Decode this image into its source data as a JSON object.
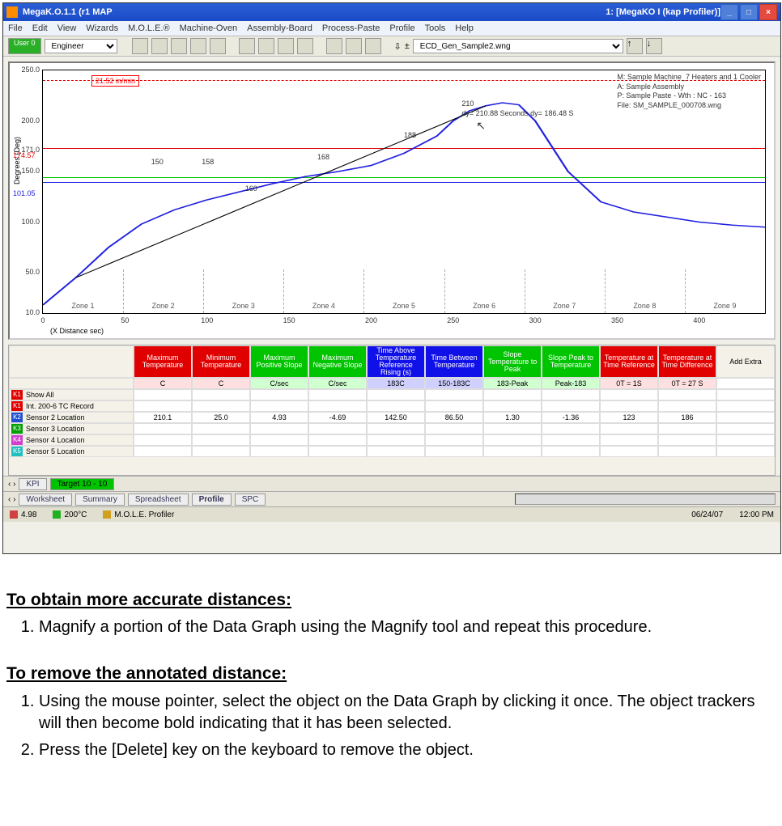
{
  "window": {
    "title1": "MegaK.O.1.1 (r1 MAP",
    "title2": "1: [MegaKO I (kap Profiler)]"
  },
  "menu": [
    "File",
    "Edit",
    "View",
    "Wizards",
    "M.O.L.E.®",
    "Machine-Oven",
    "Assembly-Board",
    "Process-Paste",
    "Profile",
    "Tools",
    "Help"
  ],
  "toolbar": {
    "user_label": "User 0",
    "role": "Engineer",
    "file_name": "ECD_Gen_Sample2.wng"
  },
  "chart_data": {
    "type": "line",
    "title": "",
    "xlabel": "",
    "ylabel": "Degrees (Deg)",
    "xlim": [
      0,
      440
    ],
    "ylim": [
      10,
      250
    ],
    "x_ticks": [
      0,
      50,
      100,
      150,
      200,
      250,
      300,
      350,
      400
    ],
    "y_ticks": [
      10,
      50,
      100,
      150,
      171,
      200,
      250
    ],
    "ref_lines": [
      {
        "label_left": "174.57",
        "y": 171,
        "color": "red"
      },
      {
        "label_left": "",
        "y": 240,
        "color": "red",
        "dashed": true
      },
      {
        "label_left": "101.05",
        "y": 140,
        "color": "blue"
      },
      {
        "label_left": "",
        "y": 145,
        "color": "green"
      }
    ],
    "zones": [
      "Zone 1",
      "Zone 2",
      "Zone 3",
      "Zone 4",
      "Zone 5",
      "Zone 6",
      "Zone 7",
      "Zone 8",
      "Zone 9"
    ],
    "series": [
      {
        "name": "Profile",
        "color": "#2020e0",
        "x": [
          0,
          20,
          40,
          60,
          80,
          100,
          120,
          140,
          160,
          180,
          200,
          220,
          240,
          250,
          260,
          270,
          280,
          290,
          300,
          320,
          340,
          360,
          380,
          400,
          420,
          440
        ],
        "y": [
          18,
          45,
          75,
          98,
          112,
          122,
          130,
          138,
          145,
          150,
          156,
          168,
          185,
          200,
          210,
          215,
          218,
          216,
          200,
          150,
          120,
          110,
          105,
          100,
          97,
          95
        ]
      }
    ],
    "annotation": "dy= 210.88 Seconds dy= 186.48  S",
    "top_left_box": "21.52 in/min",
    "labels_on_line": [
      "150",
      "158",
      "160",
      "168",
      "188",
      "210"
    ],
    "meta": [
      "M: Sample Machine_7 Heaters and 1 Cooler",
      "A: Sample Assembly",
      "P: Sample Paste - Wth : NC - 163",
      "File: SM_SAMPLE_000708.wng"
    ]
  },
  "table": {
    "headers": [
      {
        "label": "Maximum Temperature",
        "cls": "hdr-red"
      },
      {
        "label": "Minimum Temperature",
        "cls": "hdr-red"
      },
      {
        "label": "Maximum Positive Slope",
        "cls": "hdr-green"
      },
      {
        "label": "Maximum Negative Slope",
        "cls": "hdr-green"
      },
      {
        "label": "Time Above Temperature Reference Rising (s)",
        "cls": "hdr-blue"
      },
      {
        "label": "Time Between Temperature",
        "cls": "hdr-blue"
      },
      {
        "label": "Slope Temperature to Peak",
        "cls": "hdr-green"
      },
      {
        "label": "Slope Peak to Temperature",
        "cls": "hdr-green"
      },
      {
        "label": "Temperature at Time Reference",
        "cls": "hdr-red"
      },
      {
        "label": "Temperature at Time Difference",
        "cls": "hdr-red"
      },
      {
        "label": "Add Extra",
        "cls": ""
      }
    ],
    "summary_row": [
      "C",
      "C",
      "C/sec",
      "C/sec",
      "183C",
      "150-183C",
      "183-Peak",
      "Peak-183",
      "0T = 1S",
      "0T = 27 S",
      ""
    ],
    "row_labels": [
      {
        "chip": "K1",
        "color": "#e00000",
        "label": "Show All"
      },
      {
        "chip": "K1",
        "color": "#e00000",
        "label": "Int. 200-6 TC Record"
      },
      {
        "chip": "K2",
        "color": "#2050d0",
        "label": "Sensor 2 Location"
      },
      {
        "chip": "K3",
        "color": "#00a000",
        "label": "Sensor 3 Location"
      },
      {
        "chip": "K4",
        "color": "#d040d0",
        "label": "Sensor 4 Location"
      },
      {
        "chip": "K5",
        "color": "#20c0c0",
        "label": "Sensor 5 Location"
      }
    ],
    "data_rows": [
      [
        "",
        "",
        "",
        "",
        "",
        "",
        "",
        "",
        "",
        "",
        ""
      ],
      [
        "",
        "",
        "",
        "",
        "",
        "",
        "",
        "",
        "",
        "",
        ""
      ],
      [
        "210.1",
        "25.0",
        "4.93",
        "-4.69",
        "142.50",
        "86.50",
        "1.30",
        "-1.36",
        "123",
        "186",
        ""
      ],
      [
        "",
        "",
        "",
        "",
        "",
        "",
        "",
        "",
        "",
        "",
        ""
      ],
      [
        "",
        "",
        "",
        "",
        "",
        "",
        "",
        "",
        "",
        "",
        ""
      ],
      [
        "",
        "",
        "",
        "",
        "",
        "",
        "",
        "",
        "",
        "",
        ""
      ]
    ]
  },
  "lower_tabs": {
    "row1": [
      "KPI",
      "Target 10 - 10"
    ],
    "row2": [
      "Worksheet",
      "Summary",
      "Spreadsheet",
      "Profile",
      "SPC"
    ]
  },
  "statusbar": {
    "left": "4.98",
    "mid": "200°C",
    "right_label": "M.O.L.E. Profiler",
    "date": "06/24/07",
    "time": "12:00 PM"
  },
  "instructions": {
    "heading1": "To obtain more accurate distances:",
    "list1": [
      "Magnify a portion of the Data Graph using the Magnify tool and repeat this procedure."
    ],
    "heading2": "To remove the annotated distance:",
    "list2": [
      "Using the mouse pointer, select the object on the Data Graph by clicking it once. The object trackers will then become bold indicating that it has been selected.",
      "Press the [Delete] key on the keyboard to remove the object."
    ]
  }
}
